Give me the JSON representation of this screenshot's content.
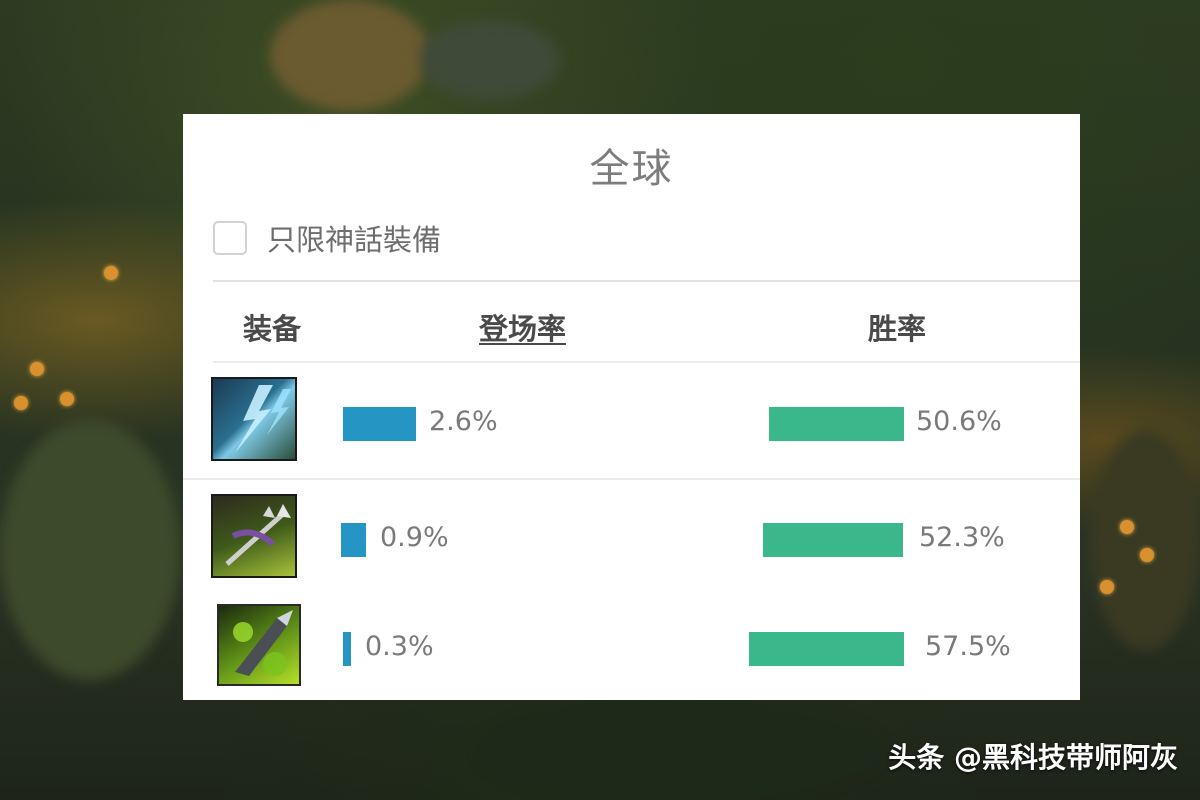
{
  "panel": {
    "title": "全球",
    "filter_label": "只限神話裝備",
    "columns": {
      "equipment": "装备",
      "pick_rate": "登场率",
      "win_rate": "胜率"
    }
  },
  "rows": [
    {
      "pick_rate": "2.6%",
      "win_rate": "50.6%",
      "pick_value": 2.6,
      "win_value": 50.6,
      "icon": "lightning-item-icon"
    },
    {
      "pick_rate": "0.9%",
      "win_rate": "52.3%",
      "pick_value": 0.9,
      "win_value": 52.3,
      "icon": "trident-item-icon"
    },
    {
      "pick_rate": "0.3%",
      "win_rate": "57.5%",
      "pick_value": 0.3,
      "win_value": 57.5,
      "icon": "green-blade-item-icon"
    }
  ],
  "colors": {
    "pick_bar": "#2596c4",
    "win_bar": "#3bb88b"
  },
  "watermark": "头条 @黑科技带师阿灰"
}
